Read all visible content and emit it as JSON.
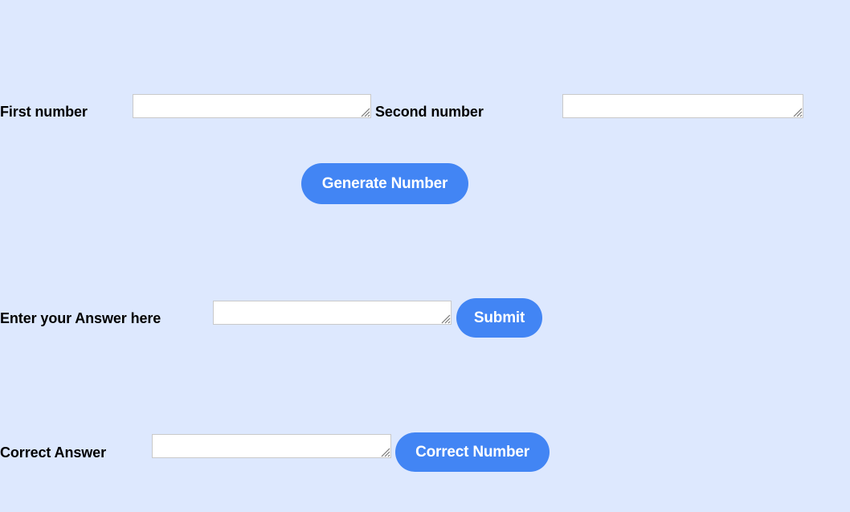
{
  "page": {
    "background_color": "#dde8fe",
    "accent_color": "#4285f4",
    "field_background": "#ffffff",
    "label_color": "#000000"
  },
  "row_first_second": {
    "first_label": "First number",
    "first_value": "",
    "first_placeholder": "",
    "second_label": "Second number",
    "second_value": "",
    "second_placeholder": ""
  },
  "generate": {
    "button_label": "Generate Number"
  },
  "row_answer": {
    "label": "Enter your Answer here",
    "value": "",
    "placeholder": "",
    "submit_label": "Submit"
  },
  "row_correct": {
    "label": "Correct Answer",
    "value": "",
    "placeholder": "",
    "button_label": "Correct Number"
  },
  "icons": {
    "resize_grip": "resize-grip-icon"
  }
}
